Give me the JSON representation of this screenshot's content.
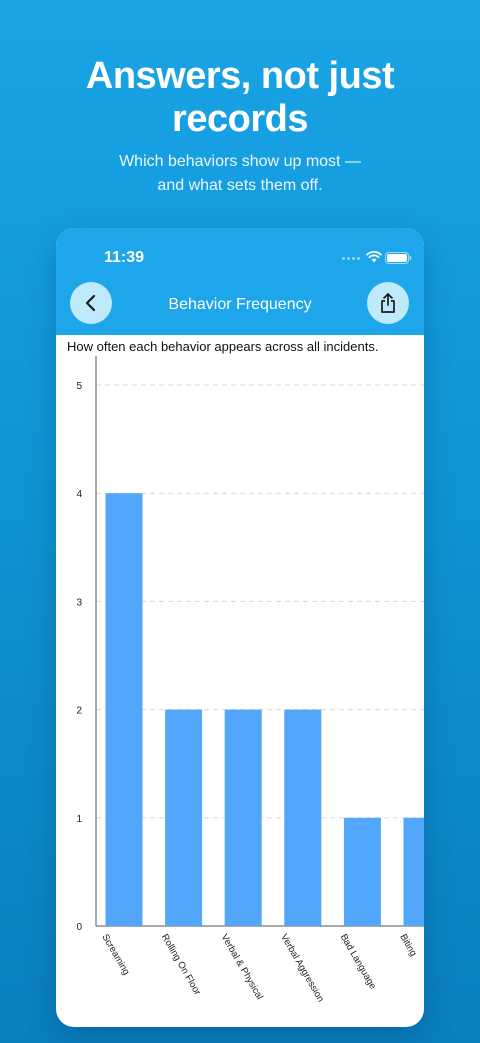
{
  "promo": {
    "headline_line1": "Answers, not just",
    "headline_line2": "records",
    "subhead_line1": "Which behaviors show up most —",
    "subhead_line2": "and what sets them off."
  },
  "status_bar": {
    "time": "11:39"
  },
  "nav": {
    "title": "Behavior Frequency"
  },
  "screen": {
    "caption": "How often each behavior appears across all incidents."
  },
  "icons": {
    "back": "chevron-left-icon",
    "share": "share-icon",
    "wifi": "wifi-icon",
    "battery": "battery-icon"
  },
  "colors": {
    "bar": "#52a6fb",
    "app_bar": "#1ea6ea",
    "button_bg": "#bfeafb",
    "background": "#12a0e2"
  },
  "chart_data": {
    "type": "bar",
    "categories": [
      "Screaming",
      "Rolling On Floor",
      "Verbal & Physical",
      "Verbal Aggression",
      "Bad Language",
      "Biting"
    ],
    "values": [
      4,
      2,
      2,
      2,
      1,
      1
    ],
    "yticks": [
      "0",
      "1",
      "2",
      "3",
      "4",
      "5"
    ],
    "ylim": [
      0,
      5
    ],
    "grid": true,
    "title": "",
    "xlabel": "",
    "ylabel": ""
  }
}
